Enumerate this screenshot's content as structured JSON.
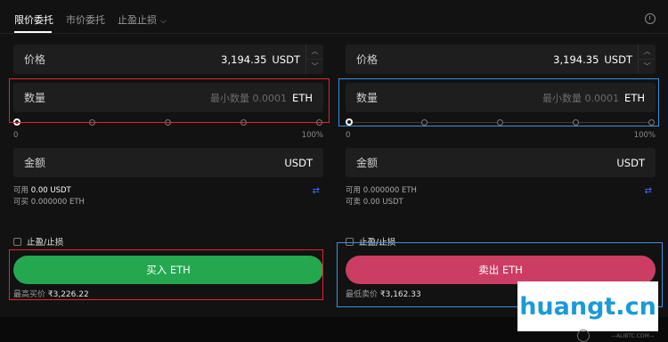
{
  "tabs": {
    "limit": "限价委托",
    "market": "市价委托",
    "tpsl": "止盈止损"
  },
  "buy": {
    "price_label": "价格",
    "price_value": "3,194.35",
    "price_unit": "USDT",
    "qty_label": "数量",
    "qty_placeholder": "最小数量 0.0001",
    "qty_unit": "ETH",
    "slider_min": "0",
    "slider_max": "100%",
    "amount_label": "金额",
    "amount_unit": "USDT",
    "available_label": "可用",
    "available_value": "0.00 USDT",
    "can_buy_label": "可买",
    "can_buy_value": "0.000000 ETH",
    "tpsl_label": "止盈/止损",
    "button_label": "买入 ETH",
    "best_label": "最高买价",
    "best_value": "₹3,226.22"
  },
  "sell": {
    "price_label": "价格",
    "price_value": "3,194.35",
    "price_unit": "USDT",
    "qty_label": "数量",
    "qty_placeholder": "最小数量 0.0001",
    "qty_unit": "ETH",
    "slider_min": "0",
    "slider_max": "100%",
    "amount_label": "金额",
    "amount_unit": "USDT",
    "available_label": "可用",
    "available_value": "0.000000 ETH",
    "can_sell_label": "可卖",
    "can_sell_value": "0.00 USDT",
    "tpsl_label": "止盈/止损",
    "button_label": "卖出 ETH",
    "best_label": "最低卖价",
    "best_value": "₹3,162.33"
  },
  "watermark": {
    "text": "huangt.cn",
    "sub": "—ALIBTC.COM—"
  },
  "colors": {
    "buy": "#25a750",
    "sell": "#cc3d63",
    "highlight_red": "#e0262f",
    "highlight_blue": "#3d8fe0"
  }
}
